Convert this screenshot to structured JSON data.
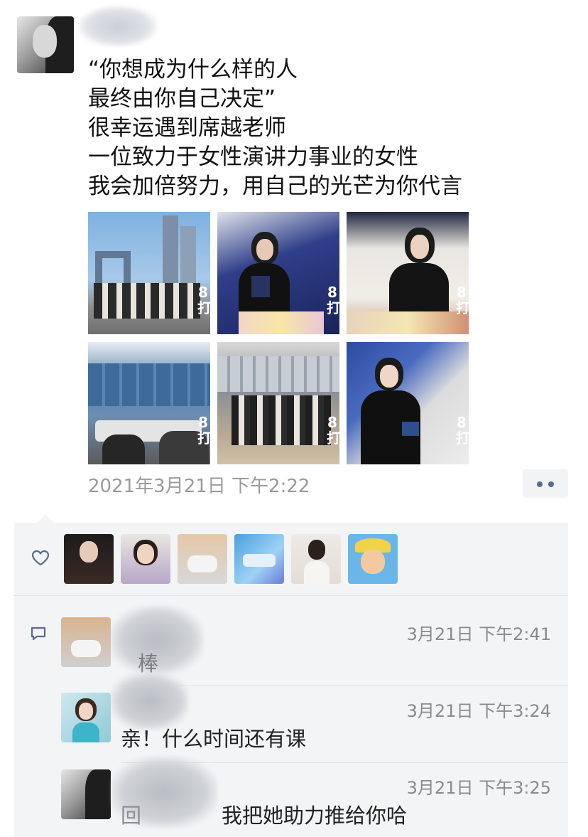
{
  "post": {
    "text_lines": [
      "“你想成为什么样的人",
      "最终由你自己决定”",
      "很幸运遇到席越老师",
      "一位致力于女性演讲力事业的女性",
      "我会加倍努力，用自己的光芒为你代言"
    ],
    "photos": [
      {
        "icon": "group-photo-cctv-tower",
        "tag": "8\n打"
      },
      {
        "icon": "woman-presenting-photo",
        "tag": "8\n打"
      },
      {
        "icon": "audience-applauding-photo",
        "tag": "8\n打"
      },
      {
        "icon": "meeting-room-photo",
        "tag": "8\n打"
      },
      {
        "icon": "group-standing-photo",
        "tag": "8\n打"
      },
      {
        "icon": "woman-speaking-photo",
        "tag": "8\n打"
      }
    ],
    "timestamp": "2021年3月21日 下午2:22"
  },
  "likes": {
    "icon": "heart-icon",
    "avatars": [
      "avatar-1",
      "avatar-2",
      "avatar-3",
      "avatar-4",
      "avatar-5",
      "avatar-6"
    ]
  },
  "comments": {
    "icon": "comment-icon",
    "items": [
      {
        "time": "3月21日 下午2:41",
        "text": "",
        "partial": "棒"
      },
      {
        "time": "3月21日 下午3:24",
        "text": "亲！什么时间还有课"
      },
      {
        "time": "3月21日 下午3:25",
        "text": "我把她助力推给你哈",
        "partial": "回"
      }
    ]
  },
  "colors": {
    "timestamp": "#9b9b9b",
    "panel_bg": "#f3f4f6",
    "more_dots": "#5a6a90",
    "icon_blue": "#5a6a90"
  }
}
